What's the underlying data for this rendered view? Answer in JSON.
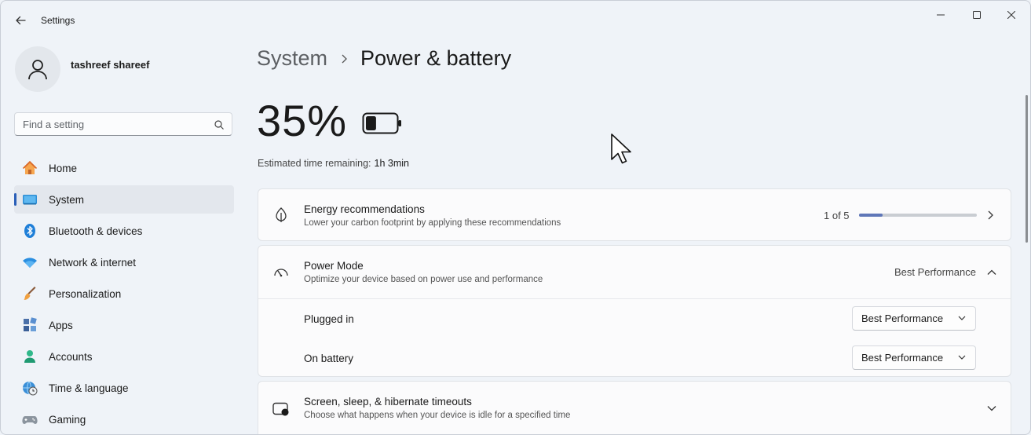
{
  "window": {
    "title": "Settings",
    "controls": [
      "minimize-icon",
      "maximize-icon",
      "close-icon"
    ]
  },
  "profile": {
    "name": "tashreef shareef"
  },
  "search": {
    "placeholder": "Find a setting"
  },
  "sidebar": {
    "items": [
      {
        "label": "Home",
        "icon": "home-icon",
        "active": false
      },
      {
        "label": "System",
        "icon": "system-icon",
        "active": true
      },
      {
        "label": "Bluetooth & devices",
        "icon": "bluetooth-icon",
        "active": false
      },
      {
        "label": "Network & internet",
        "icon": "wifi-icon",
        "active": false
      },
      {
        "label": "Personalization",
        "icon": "brush-icon",
        "active": false
      },
      {
        "label": "Apps",
        "icon": "apps-icon",
        "active": false
      },
      {
        "label": "Accounts",
        "icon": "accounts-icon",
        "active": false
      },
      {
        "label": "Time & language",
        "icon": "globe-clock-icon",
        "active": false
      },
      {
        "label": "Gaming",
        "icon": "gamepad-icon",
        "active": false
      }
    ]
  },
  "breadcrumb": {
    "parent": "System",
    "current": "Power & battery"
  },
  "battery": {
    "percent_label": "35%",
    "level": 0.35,
    "estimate_label": "Estimated time remaining:",
    "estimate_value": "1h 3min"
  },
  "energy": {
    "title": "Energy recommendations",
    "subtitle": "Lower your carbon footprint by applying these recommendations",
    "count_label": "1 of 5",
    "progress_fraction": 0.2
  },
  "power_mode": {
    "title": "Power Mode",
    "subtitle": "Optimize your device based on power use and performance",
    "value": "Best Performance",
    "rows": [
      {
        "label": "Plugged in",
        "value": "Best Performance"
      },
      {
        "label": "On battery",
        "value": "Best Performance"
      }
    ]
  },
  "sleep": {
    "title": "Screen, sleep, & hibernate timeouts",
    "subtitle": "Choose what happens when your device is idle for a specified time"
  },
  "colors": {
    "accent": "#2a5fb8",
    "progress": "#5f77b8",
    "background": "#eff3f8"
  }
}
